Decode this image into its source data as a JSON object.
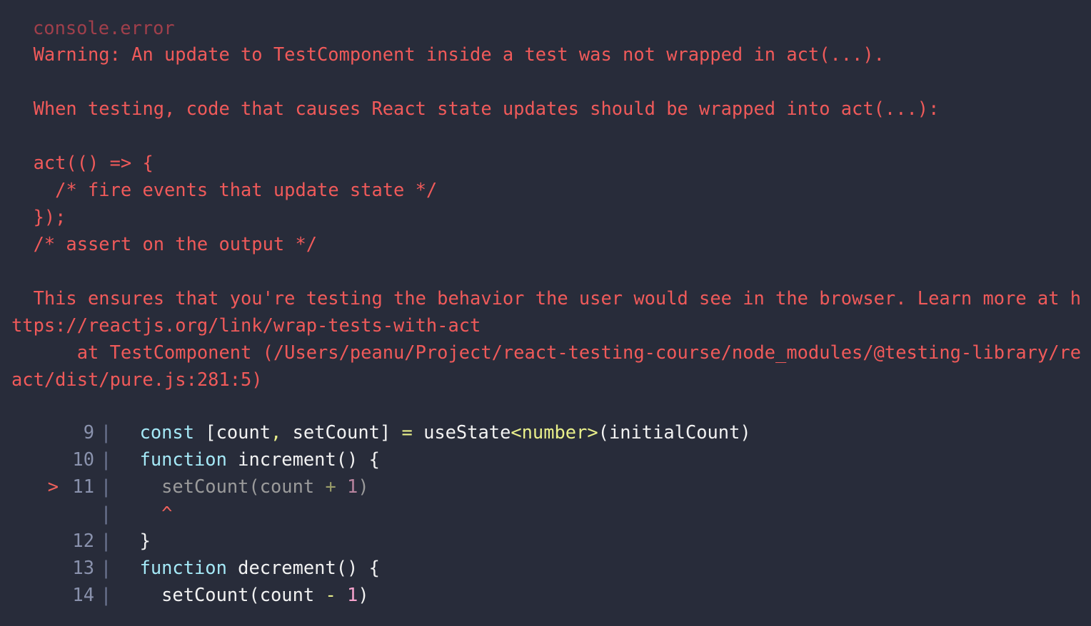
{
  "theme": {
    "background": "#282c3a",
    "console_label_color": "#a03f4b",
    "error_text_color": "#f05a5a",
    "line_number_color": "#8a92ad",
    "pipe_color": "#6f7895",
    "marker_color": "#f0625c",
    "keyword_color": "#a5e9f7",
    "plain_color": "#f2f2f2",
    "operator_color": "#e9ef8a",
    "number_color": "#f6a3cd",
    "dimmed_color": "#9b9b9b"
  },
  "console": {
    "label": "console.error"
  },
  "warning": {
    "text": "  Warning: An update to TestComponent inside a test was not wrapped in act(...).\n\n  When testing, code that causes React state updates should be wrapped into act(...):\n\n  act(() => {\n    /* fire events that update state */\n  });\n  /* assert on the output */\n\n  This ensures that you're testing the behavior the user would see in the browser. Learn more at https://reactjs.org/link/wrap-tests-with-act\n      at TestComponent (/Users/peanu/Project/react-testing-course/node_modules/@testing-library/react/dist/pure.js:281:5)"
  },
  "code_frame": {
    "rows": [
      {
        "marker": "",
        "number": "9",
        "pipe": "|",
        "dimmed": false,
        "tokens": [
          {
            "text": "  ",
            "type": "plain"
          },
          {
            "text": "const",
            "type": "kw"
          },
          {
            "text": " [count",
            "type": "plain"
          },
          {
            "text": ",",
            "type": "op"
          },
          {
            "text": " setCount] ",
            "type": "plain"
          },
          {
            "text": "=",
            "type": "op"
          },
          {
            "text": " useState",
            "type": "plain"
          },
          {
            "text": "<number>",
            "type": "type"
          },
          {
            "text": "(initialCount)",
            "type": "plain"
          }
        ]
      },
      {
        "marker": "",
        "number": "10",
        "pipe": "|",
        "dimmed": false,
        "tokens": [
          {
            "text": "  ",
            "type": "plain"
          },
          {
            "text": "function",
            "type": "kw"
          },
          {
            "text": " increment() {",
            "type": "plain"
          }
        ]
      },
      {
        "marker": ">",
        "number": "11",
        "pipe": "|",
        "dimmed": true,
        "tokens": [
          {
            "text": "    setCount(count ",
            "type": "plain"
          },
          {
            "text": "+",
            "type": "op"
          },
          {
            "text": " ",
            "type": "plain"
          },
          {
            "text": "1",
            "type": "num"
          },
          {
            "text": ")",
            "type": "plain"
          }
        ]
      },
      {
        "marker": "",
        "number": "",
        "pipe": "|",
        "dimmed": false,
        "caret": "    ^",
        "tokens": []
      },
      {
        "marker": "",
        "number": "12",
        "pipe": "|",
        "dimmed": false,
        "tokens": [
          {
            "text": "  }",
            "type": "plain"
          }
        ]
      },
      {
        "marker": "",
        "number": "13",
        "pipe": "|",
        "dimmed": false,
        "tokens": [
          {
            "text": "  ",
            "type": "plain"
          },
          {
            "text": "function",
            "type": "kw"
          },
          {
            "text": " decrement() {",
            "type": "plain"
          }
        ]
      },
      {
        "marker": "",
        "number": "14",
        "pipe": "|",
        "dimmed": false,
        "tokens": [
          {
            "text": "    setCount(count ",
            "type": "plain"
          },
          {
            "text": "-",
            "type": "op"
          },
          {
            "text": " ",
            "type": "plain"
          },
          {
            "text": "1",
            "type": "num"
          },
          {
            "text": ")",
            "type": "plain"
          }
        ]
      }
    ]
  }
}
